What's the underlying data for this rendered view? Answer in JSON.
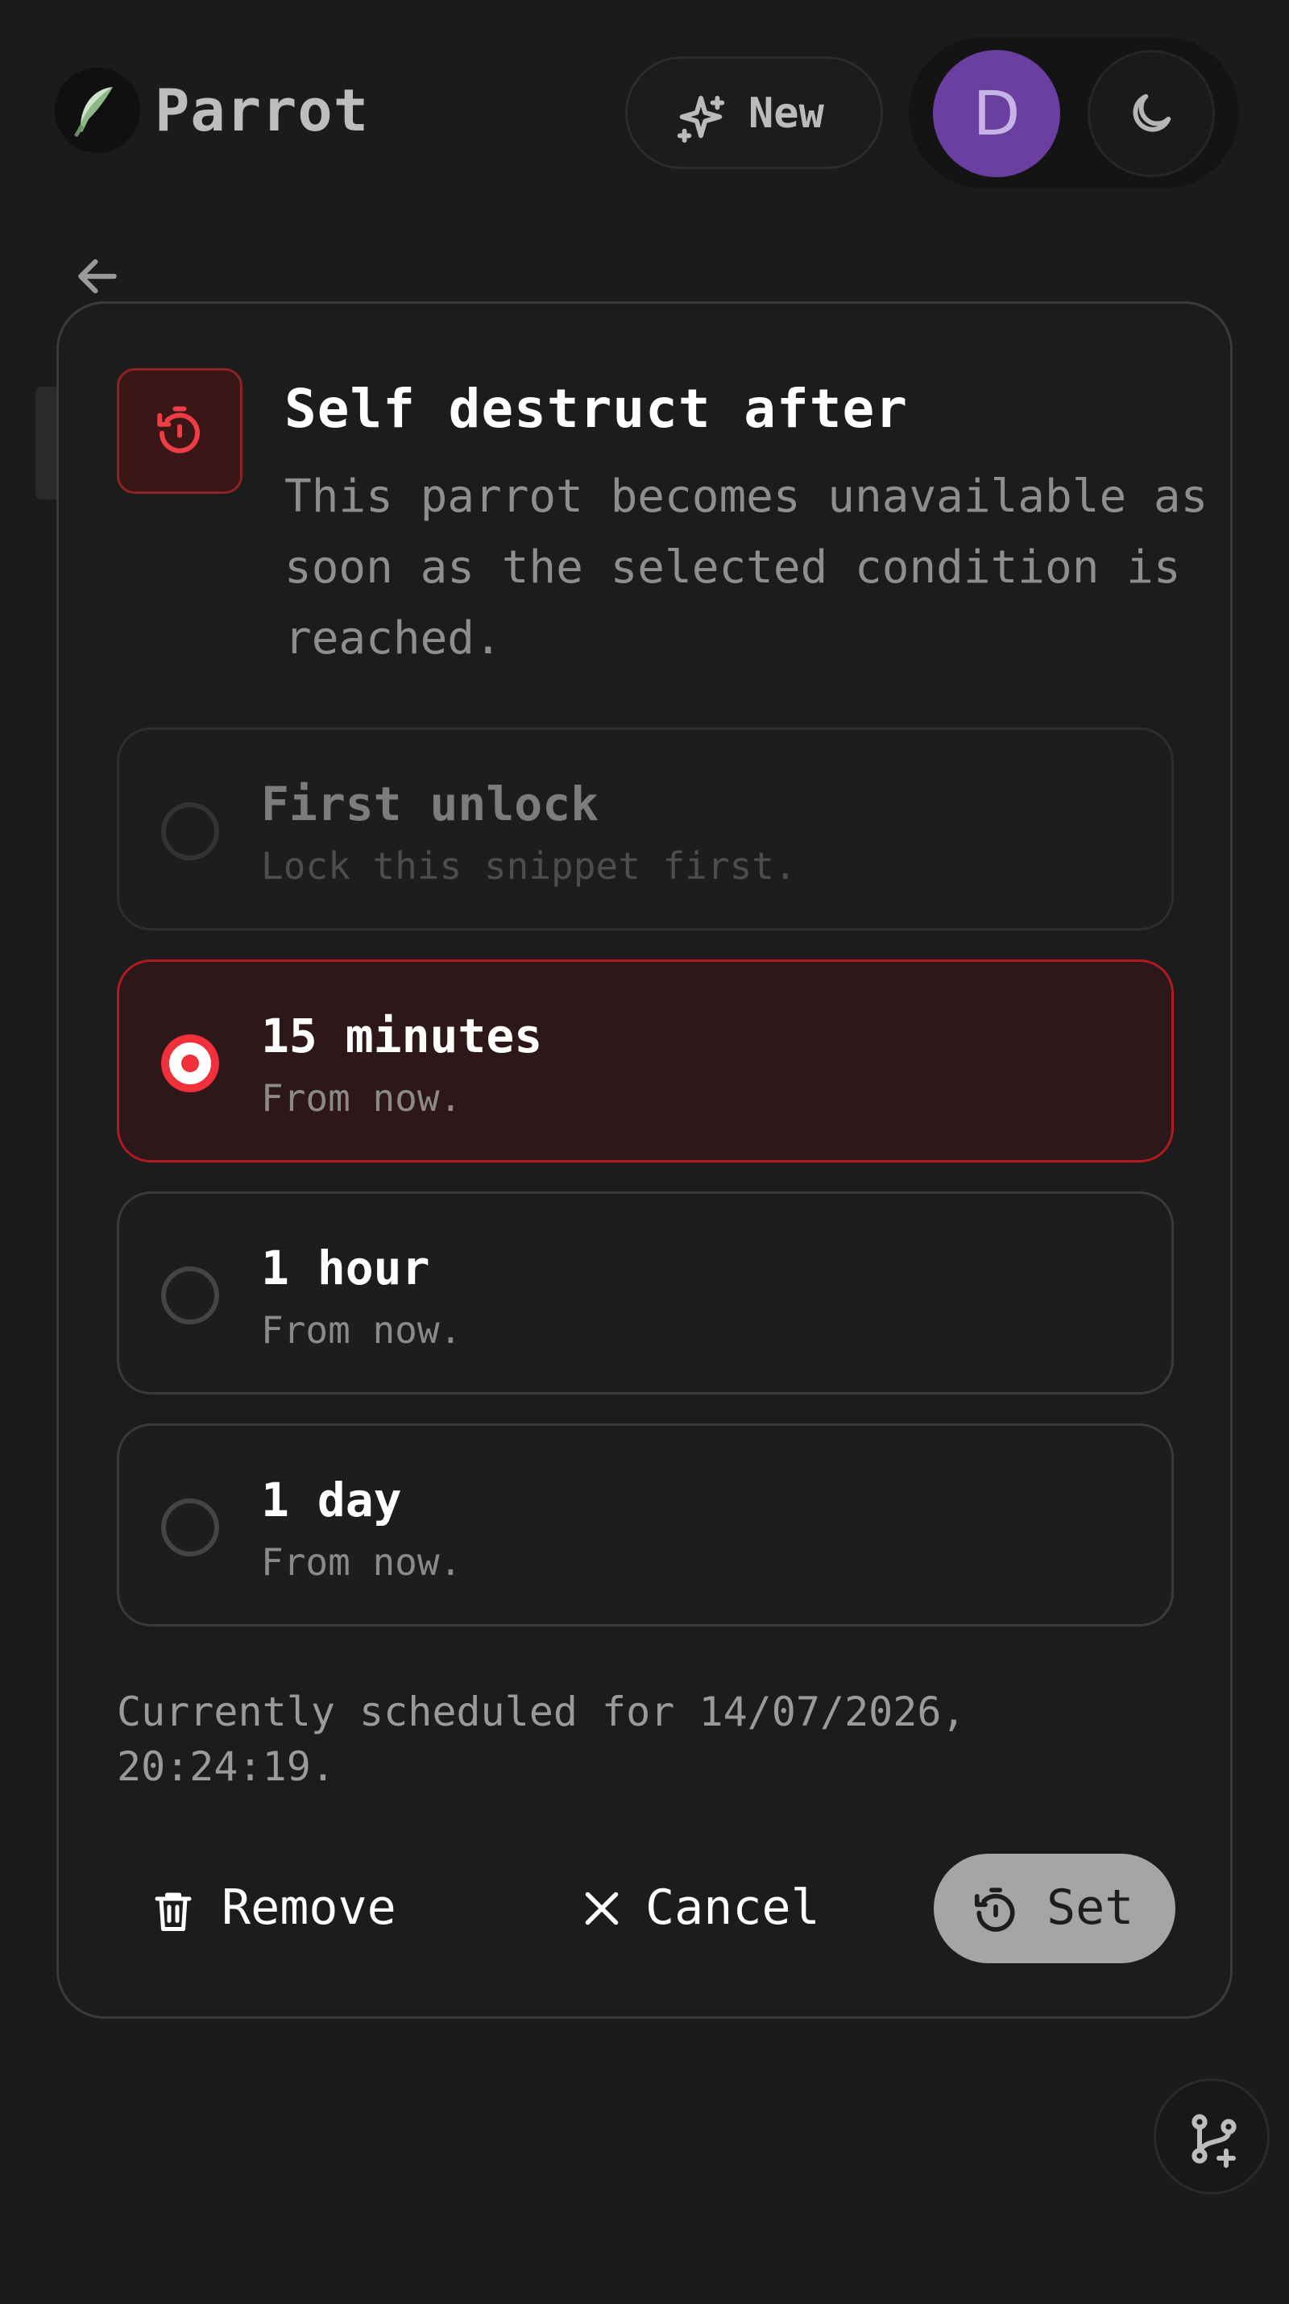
{
  "header": {
    "brand": "Parrot",
    "new_label": "New",
    "avatar_initial": "D"
  },
  "modal": {
    "title": "Self destruct after",
    "description": "This parrot becomes unavailable as soon as the selected condition is reached.",
    "options": [
      {
        "label": "First unlock",
        "sub": "Lock this snippet first.",
        "state": "disabled"
      },
      {
        "label": "15 minutes",
        "sub": "From now.",
        "state": "selected"
      },
      {
        "label": "1 hour",
        "sub": "From now.",
        "state": "unselected"
      },
      {
        "label": "1 day",
        "sub": "From now.",
        "state": "unselected"
      }
    ],
    "scheduled_text": "Currently scheduled for 14/07/2026, 20:24:19.",
    "buttons": {
      "remove": "Remove",
      "cancel": "Cancel",
      "set": "Set"
    }
  },
  "colors": {
    "accent_red": "#f0303a",
    "selected_bg": "#2d1718",
    "avatar": "#6a3fa0"
  },
  "icons": [
    "logo-icon",
    "sparkles-icon",
    "moon-icon",
    "back-arrow-icon",
    "timer-icon",
    "trash-icon",
    "close-icon",
    "git-branch-icon"
  ]
}
